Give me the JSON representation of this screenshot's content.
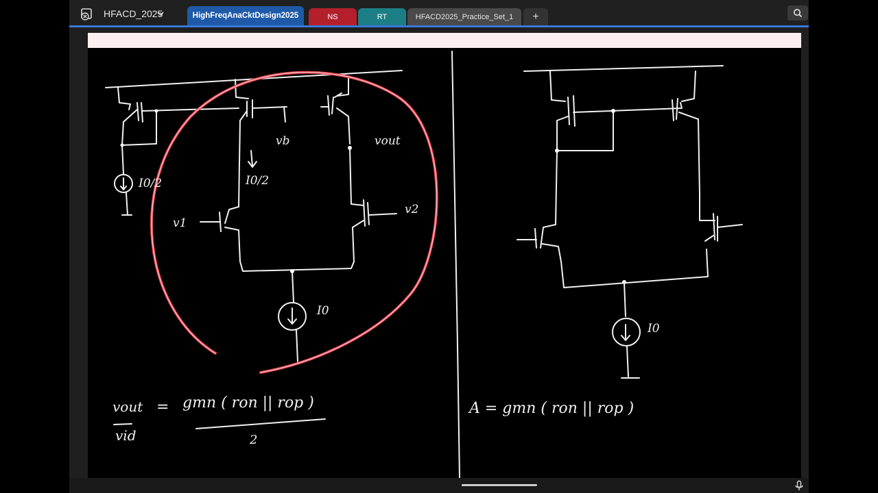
{
  "app": {
    "notebook_name": "HFACD_2025",
    "icons": {
      "app": "app-icon",
      "dropdown": "chevron-down-icon",
      "search": "search-icon",
      "mic": "microphone-icon",
      "add": "plus-icon"
    },
    "colors": {
      "accent": "#3a78d8",
      "page_header": "#fbefef",
      "highlight_circle": "#e0404e"
    }
  },
  "tabs": [
    {
      "label": "HighFreqAnaCktDesign2025",
      "color": "#1e5aa8",
      "active": true
    },
    {
      "label": "NS",
      "color": "#b3202c",
      "active": false
    },
    {
      "label": "RT",
      "color": "#1c7f86",
      "active": false
    },
    {
      "label": "HFACD2025_Practice_Set_1",
      "color": "#4a4a4a",
      "active": false
    }
  ],
  "add_tab_label": "+",
  "notes": {
    "left_circuit": {
      "vb": "vb",
      "vout": "vout",
      "i0_half_mirror": "I0/2",
      "i0_half_branch": "I0/2",
      "v1": "v1",
      "v2": "v2",
      "i0": "I0"
    },
    "left_equation": {
      "numerator_lhs": "vout",
      "denominator_lhs": "vid",
      "equals": "=",
      "rhs_numerator": "gmn ( ron || rop )",
      "rhs_denominator": "2"
    },
    "right_circuit": {
      "i0": "I0"
    },
    "right_equation": "A = gmn ( ron || rop )"
  }
}
